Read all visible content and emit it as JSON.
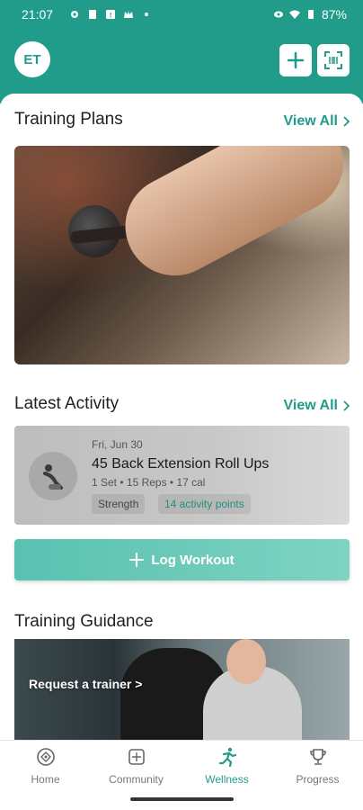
{
  "status_bar": {
    "time": "21:07",
    "battery": "87%"
  },
  "header": {
    "avatar_initials": "ET"
  },
  "training_plans": {
    "title": "Training Plans",
    "view_all": "View All"
  },
  "latest_activity": {
    "title": "Latest Activity",
    "view_all": "View All",
    "item": {
      "date": "Fri, Jun 30",
      "name": "45 Back Extension Roll Ups",
      "meta": "1 Set • 15 Reps • 17 cal",
      "tags": [
        "Strength",
        "14 activity points"
      ]
    }
  },
  "log_workout": {
    "label": "Log Workout"
  },
  "training_guidance": {
    "title": "Training Guidance",
    "cta": "Request a trainer >"
  },
  "tabs": [
    {
      "label": "Home",
      "icon": "home-icon",
      "active": false
    },
    {
      "label": "Community",
      "icon": "community-icon",
      "active": false
    },
    {
      "label": "Wellness",
      "icon": "wellness-icon",
      "active": true
    },
    {
      "label": "Progress",
      "icon": "trophy-icon",
      "active": false
    }
  ],
  "colors": {
    "accent": "#219c8a",
    "button": "#66c8b7"
  }
}
